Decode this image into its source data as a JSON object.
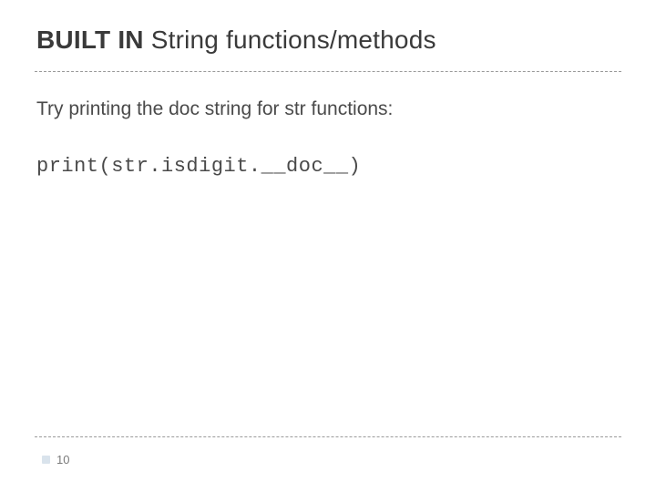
{
  "title": {
    "bold_part": "BUILT IN",
    "rest": " String functions/methods"
  },
  "body": "Try printing the doc string for str functions:",
  "code": "print(str.isdigit.__doc__)",
  "page_number": "10"
}
